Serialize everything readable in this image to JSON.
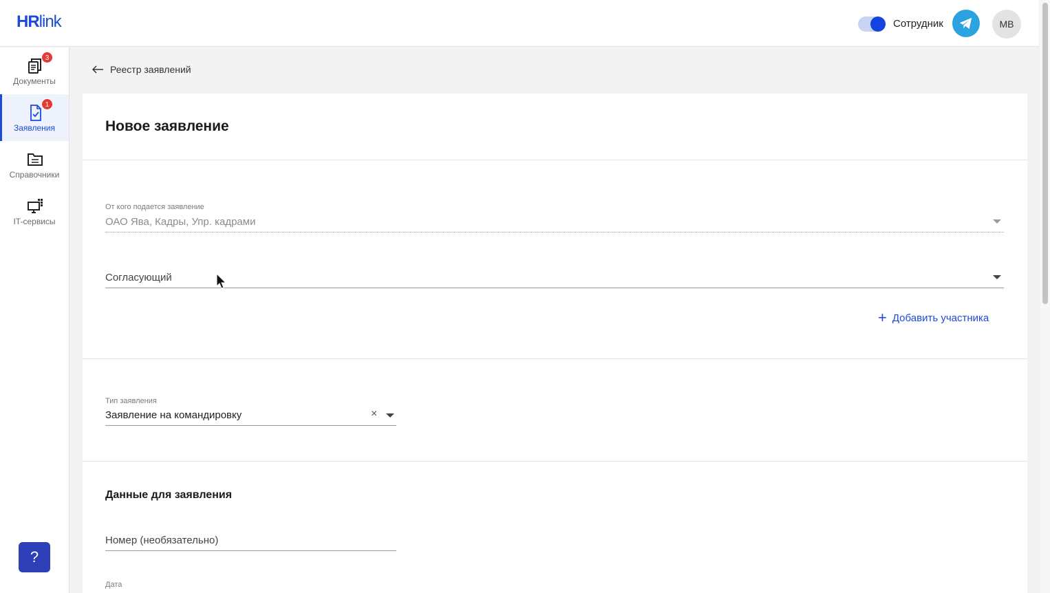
{
  "header": {
    "logo_hr": "HR",
    "logo_link": "link",
    "role_label": "Сотрудник",
    "avatar_initials": "МВ",
    "telegram_icon": "telegram-icon",
    "toggle_state": "on",
    "accent_color": "#1d4bd8"
  },
  "sidebar": {
    "items": [
      {
        "label": "Документы",
        "badge": "3",
        "icon": "documents-icon"
      },
      {
        "label": "Заявления",
        "badge": "1",
        "icon": "request-icon",
        "active": true
      },
      {
        "label": "Справочники",
        "icon": "folder-icon"
      },
      {
        "label": "IT-сервисы",
        "icon": "it-services-icon"
      }
    ],
    "help_label": "?"
  },
  "breadcrumb": {
    "back_label": "Реестр заявлений"
  },
  "form": {
    "title": "Новое заявление",
    "from": {
      "label": "От кого подается заявление",
      "value": "ОАО Ява, Кадры, Упр. кадрами"
    },
    "approver": {
      "placeholder": "Согласующий"
    },
    "add_participant_label": "Добавить участника",
    "type": {
      "label": "Тип заявления",
      "value": "Заявление на командировку",
      "clear_symbol": "×"
    },
    "data_section_title": "Данные для заявления",
    "number": {
      "placeholder": "Номер (необязательно)"
    },
    "date": {
      "label": "Дата"
    }
  }
}
